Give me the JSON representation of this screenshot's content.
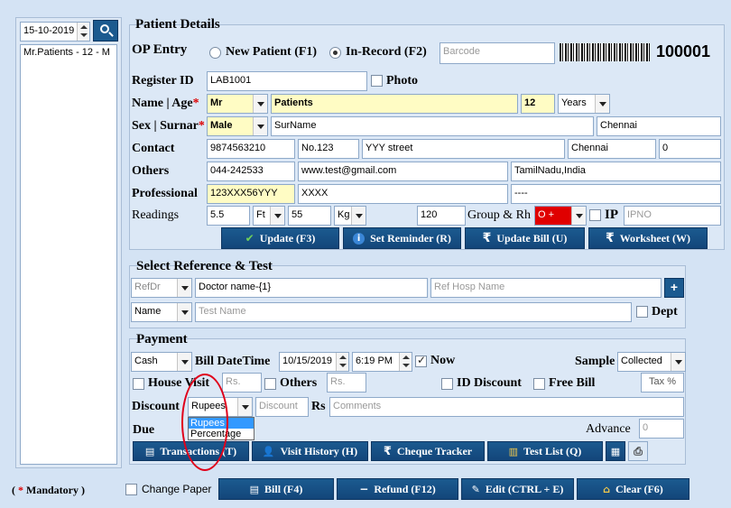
{
  "left": {
    "date": "15-10-2019",
    "list_item": "Mr.Patients - 12 - M"
  },
  "patient": {
    "section_title": "Patient Details",
    "op_entry_label": "OP Entry",
    "new_patient_label": "New Patient (F1)",
    "in_record_label": "In-Record (F2)",
    "barcode_placeholder": "Barcode",
    "barcode_number": "100001",
    "register_id_label": "Register ID",
    "register_id_value": "LAB1001",
    "photo_label": "Photo",
    "name_age_label": "Name | Age",
    "title_value": "Mr",
    "name_value": "Patients",
    "age_value": "12",
    "age_unit": "Years",
    "sex_label": "Sex | Surnar",
    "sex_value": "Male",
    "surname_value": "SurName",
    "city_top": "Chennai",
    "contact_label": "Contact",
    "phone": "9874563210",
    "address1": "No.123",
    "address2": "YYY street",
    "city": "Chennai",
    "pincode": "0",
    "others_label": "Others",
    "alt_phone": "044-242533",
    "email": "www.test@gmail.com",
    "state": "TamilNadu,India",
    "professional_label": "Professional",
    "prof_id": "123XXX56YYY",
    "prof_name": "XXXX",
    "prof_extra": "----",
    "readings_label": "Readings",
    "height_value": "5.5",
    "height_unit": "Ft",
    "weight_value": "55",
    "weight_unit": "Kg",
    "bp_value": "120",
    "group_label": "Group & Rh",
    "blood_group": "O +",
    "ip_label": "IP",
    "ipno_placeholder": "IPNO",
    "mandatory_mark": "*"
  },
  "actions": {
    "update": "Update (F3)",
    "set_reminder": "Set Reminder (R)",
    "update_bill": "Update Bill (U)",
    "worksheet": "Worksheet (W)"
  },
  "reference": {
    "section_title": "Select Reference & Test",
    "refdr": "RefDr",
    "doctor_name": "Doctor name-{1}",
    "ref_hosp_placeholder": "Ref Hosp Name",
    "name_combo": "Name",
    "test_name_placeholder": "Test Name",
    "dept_label": "Dept"
  },
  "payment": {
    "section_title": "Payment",
    "pay_mode": "Cash",
    "bill_datetime_label": "Bill DateTime",
    "bill_date": "10/15/2019",
    "bill_time": "6:19 PM",
    "now_label": "Now",
    "sample_label": "Sample",
    "sample_value": "Collected",
    "house_visit_label": "House Visit",
    "rs_placeholder_1": "Rs.",
    "others_label": "Others",
    "rs_placeholder_2": "Rs.",
    "id_discount_label": "ID Discount",
    "free_bill_label": "Free Bill",
    "tax_label": "Tax %",
    "discount_label": "Discount",
    "discount_type": "Rupees",
    "discount_placeholder": "Discount",
    "rs_label": "Rs",
    "comments_placeholder": "Comments",
    "due_label": "Due",
    "advance_label": "Advance",
    "advance_value": "0",
    "dropdown_options": [
      "Rupees",
      "Percentage"
    ]
  },
  "bottom_tabs": {
    "transactions": "Transactions (T)",
    "visit_history": "Visit History (H)",
    "cheque_tracker": "Cheque Tracker",
    "test_list": "Test List (Q)"
  },
  "footer": {
    "mandatory_note_star": "*",
    "mandatory_note": "Mandatory )",
    "mandatory_open": "(",
    "change_paper": "Change Paper",
    "bill": "Bill (F4)",
    "refund": "Refund (F12)",
    "edit": "Edit (CTRL + E)",
    "clear": "Clear (F6)"
  },
  "colors": {
    "background": "#d4e3f4",
    "button": "#1b5a8f",
    "mandatory_yellow": "#fffcc4",
    "blood_group_red": "#e00000",
    "annotation_red": "#e0001a"
  }
}
